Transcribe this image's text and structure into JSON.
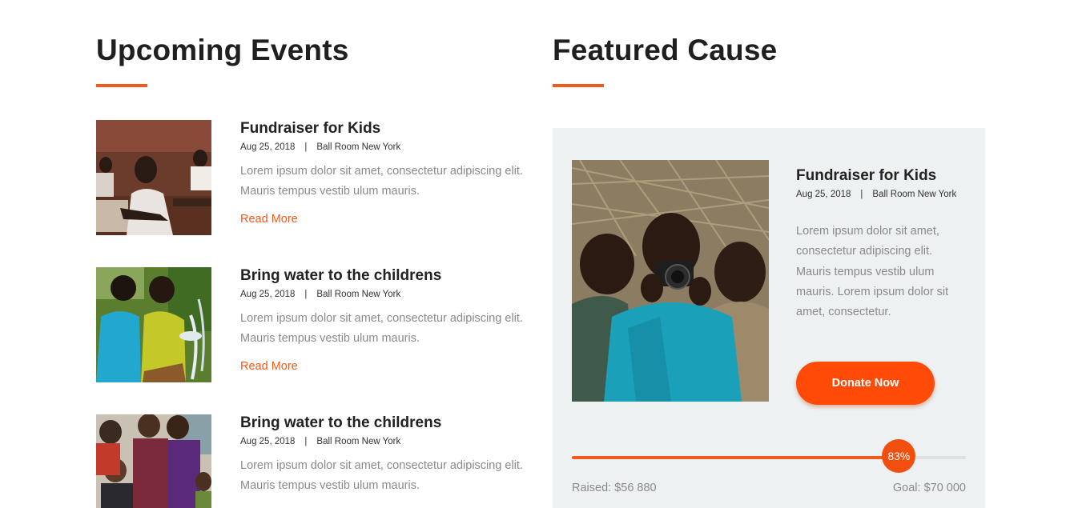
{
  "events_section": {
    "title": "Upcoming Events",
    "accent_color": "#f05a1a",
    "events": [
      {
        "title": "Fundraiser for Kids",
        "date": "Aug 25, 2018",
        "location": "Ball Room New York",
        "excerpt": "Lorem ipsum dolor sit amet, consectetur adipiscing elit. Mauris tempus vestib ulum mauris.",
        "link": "Read More",
        "image": "children-in-classroom-photo"
      },
      {
        "title": "Bring water to the childrens",
        "date": "Aug 25, 2018",
        "location": "Ball Room New York",
        "excerpt": "Lorem ipsum dolor sit amet, consectetur adipiscing elit. Mauris tempus vestib ulum mauris.",
        "link": "Read More",
        "image": "children-playing-with-water-photo"
      },
      {
        "title": "Bring water to the childrens",
        "date": "Aug 25, 2018",
        "location": "Ball Room New York",
        "excerpt": "Lorem ipsum dolor sit amet, consectetur adipiscing elit. Mauris tempus vestib ulum mauris.",
        "image": "group-of-smiling-children-photo"
      }
    ]
  },
  "featured_section": {
    "title": "Featured Cause",
    "cause": {
      "title": "Fundraiser for Kids",
      "date": "Aug 25, 2018",
      "location": "Ball Room New York",
      "description": "Lorem ipsum dolor sit amet, consectetur adipiscing elit. Mauris tempus vestib ulum mauris. Lorem ipsum dolor sit amet, consectetur.",
      "image": "boy-with-camera-photo",
      "donate_label": "Donate Now",
      "progress_fraction": 0.83,
      "progress_label": "83%",
      "raised_text": "Raised: $56 880",
      "goal_text": "Goal: $70 000"
    },
    "background_color": "#edf1f2",
    "button_color": "#ff4a08"
  }
}
